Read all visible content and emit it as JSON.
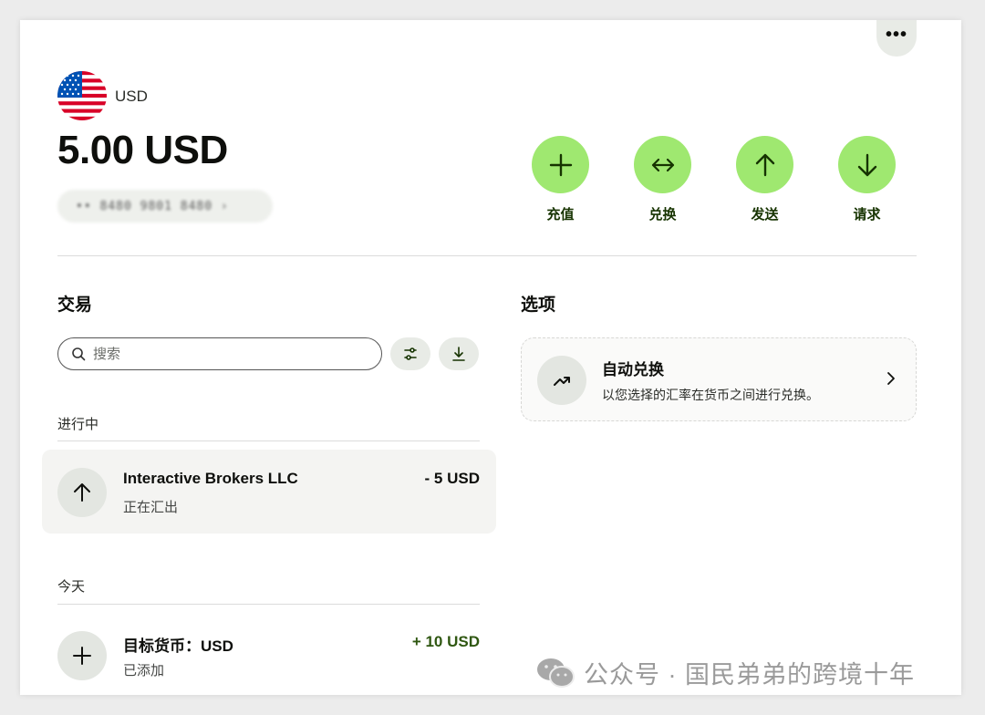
{
  "balance_card": {
    "currency_code": "USD",
    "balance": "5.00 USD",
    "account_number_masked": "•• 8480 9801 8480 ›"
  },
  "actions": [
    {
      "label": "充值",
      "icon": "plus-icon"
    },
    {
      "label": "兑换",
      "icon": "exchange-arrows-icon"
    },
    {
      "label": "发送",
      "icon": "arrow-up-icon"
    },
    {
      "label": "请求",
      "icon": "arrow-down-icon"
    }
  ],
  "transactions": {
    "title": "交易",
    "search_placeholder": "搜索",
    "groups": [
      {
        "label": "进行中",
        "items": [
          {
            "title": "Interactive Brokers LLC",
            "subtitle": "正在汇出",
            "amount": "- 5 USD",
            "icon": "arrow-up-icon"
          }
        ]
      },
      {
        "label": "今天",
        "items": [
          {
            "title": "目标货币：USD",
            "subtitle": "已添加",
            "amount": "+ 10 USD",
            "icon": "plus-icon"
          }
        ]
      }
    ]
  },
  "options": {
    "title": "选项",
    "items": [
      {
        "title": "自动兑换",
        "description": "以您选择的汇率在货币之间进行兑换。",
        "icon": "trend-up-icon"
      }
    ]
  },
  "watermark": {
    "text": "公众号 · 国民弟弟的跨境十年",
    "icon": "wechat-icon"
  },
  "colors": {
    "accent_green": "#9fe870",
    "dark_green": "#163300",
    "positive_amount": "#2f5711"
  }
}
